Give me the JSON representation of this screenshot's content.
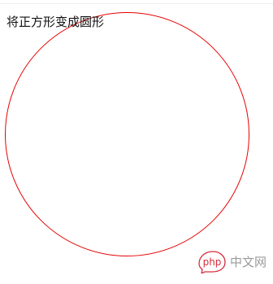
{
  "page": {
    "text": "将正方形变成圆形"
  },
  "shape": {
    "border_color": "#e60000"
  },
  "watermark": {
    "logo_text": "php",
    "site_label": "中文网",
    "logo_color": "#d62b3a"
  }
}
